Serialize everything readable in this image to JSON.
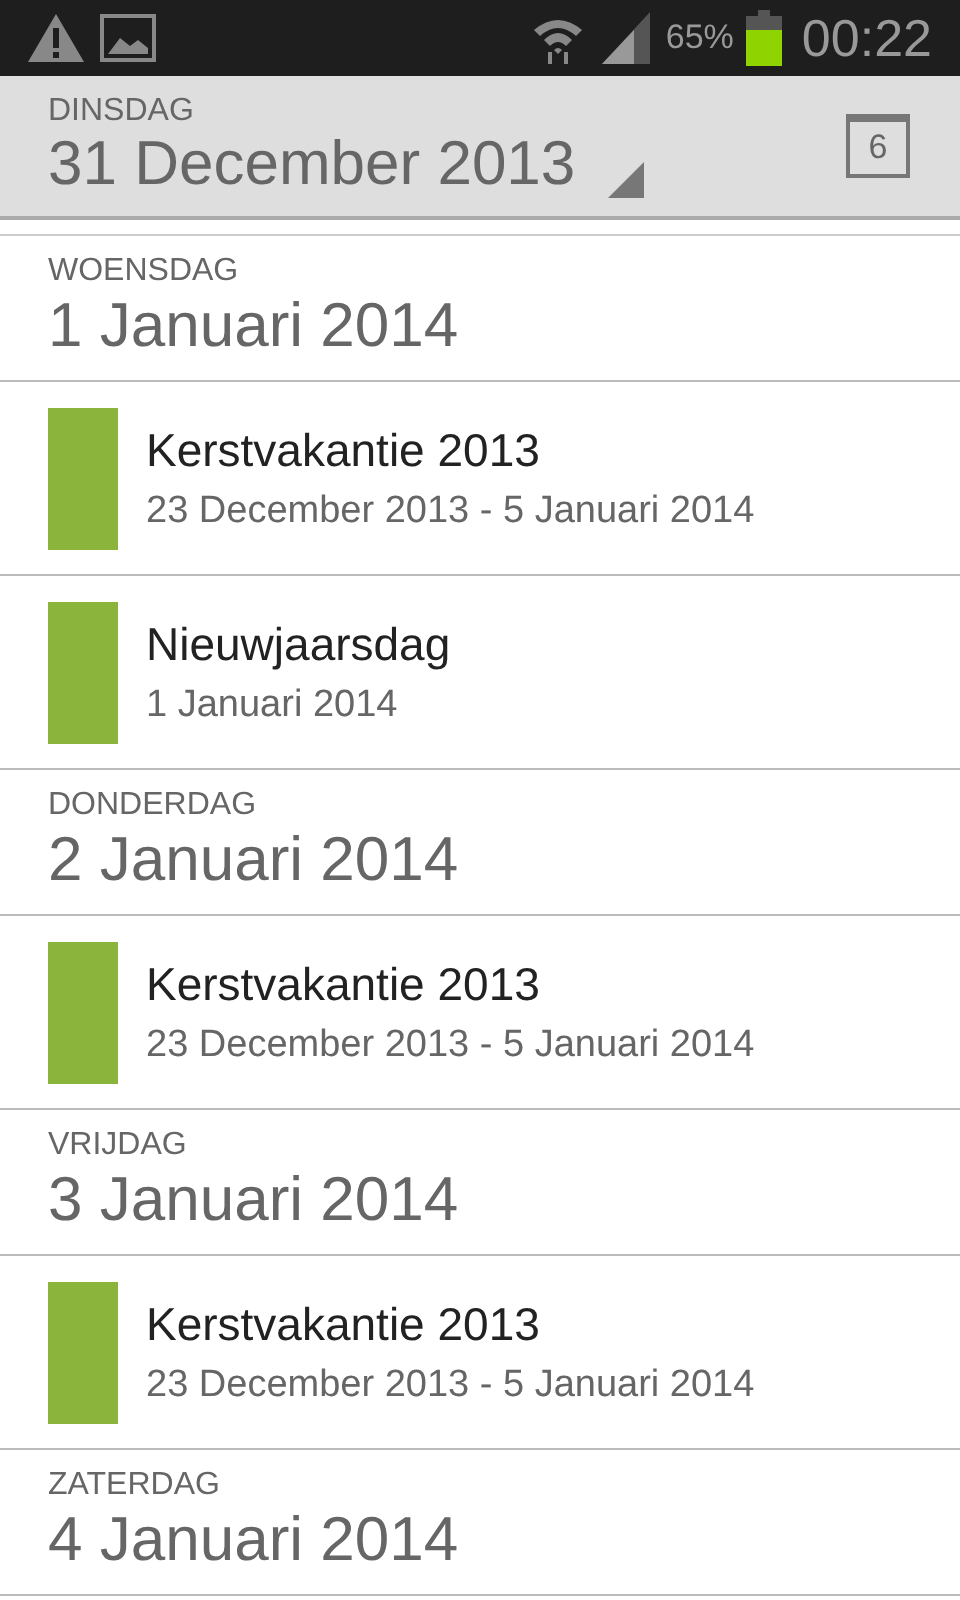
{
  "status_bar": {
    "battery_percent": "65%",
    "time": "00:22"
  },
  "header": {
    "weekday": "DINSDAG",
    "date": "31 December 2013",
    "calendar_day": "6"
  },
  "agenda": [
    {
      "kind": "day",
      "weekday": "WOENSDAG",
      "date": "1 Januari 2014"
    },
    {
      "kind": "event",
      "title": "Kerstvakantie 2013",
      "when": "23 December 2013 - 5 Januari 2014",
      "color": "#8ab43c"
    },
    {
      "kind": "event",
      "title": "Nieuwjaarsdag",
      "when": "1 Januari 2014",
      "color": "#8ab43c"
    },
    {
      "kind": "day",
      "weekday": "DONDERDAG",
      "date": "2 Januari 2014"
    },
    {
      "kind": "event",
      "title": "Kerstvakantie 2013",
      "when": "23 December 2013 - 5 Januari 2014",
      "color": "#8ab43c"
    },
    {
      "kind": "day",
      "weekday": "VRIJDAG",
      "date": "3 Januari 2014"
    },
    {
      "kind": "event",
      "title": "Kerstvakantie 2013",
      "when": "23 December 2013 - 5 Januari 2014",
      "color": "#8ab43c"
    },
    {
      "kind": "day",
      "weekday": "ZATERDAG",
      "date": "4 Januari 2014"
    }
  ]
}
